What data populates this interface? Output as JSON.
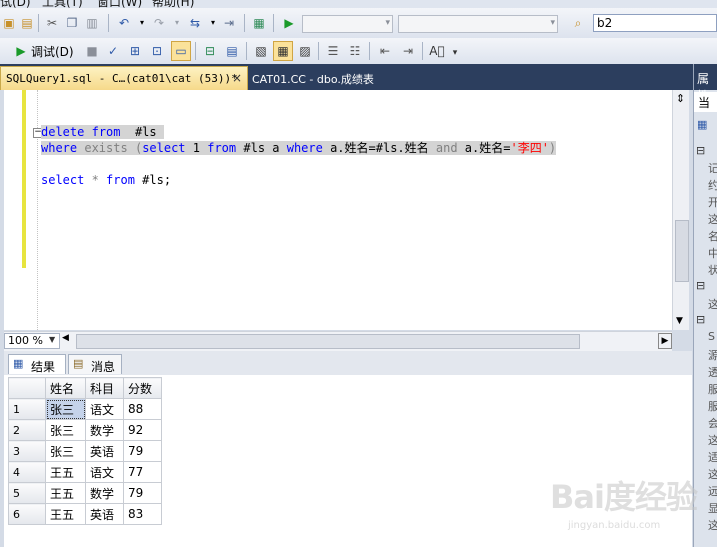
{
  "menubar": {
    "items": [
      "试(D)",
      "工具(T)",
      "窗口(W)",
      "帮助(H)"
    ]
  },
  "toolbar1": {
    "search_value": "b2"
  },
  "toolbar2": {
    "debug_label": "调试(D)"
  },
  "tabs": [
    {
      "label": "SQLQuery1.sql - C…(cat01\\cat (53))*",
      "close": "×",
      "active": true
    },
    {
      "label": "CAT01.CC - dbo.成绩表",
      "active": false
    }
  ],
  "editor": {
    "line1": {
      "kw1": "delete",
      "kw2": "from",
      "rest": "#ls"
    },
    "line2": {
      "kw_where": "where",
      "exists": "exists",
      "paren_open": "(",
      "kw_select": "select",
      "one": " 1 ",
      "kw_from": "from",
      "mid": " #ls a ",
      "kw_where2": "where",
      "cond": " a.姓名=#ls.姓名 ",
      "and": "and",
      "cond2": " a.姓名=",
      "str": "'李四'",
      "paren_close": ")"
    },
    "line3": {
      "kw_select": "select",
      "star": " * ",
      "kw_from": "from",
      "rest": " #ls;"
    }
  },
  "zoom": "100 %",
  "results_tabs": [
    {
      "label": "结果",
      "icon": "grid-icon"
    },
    {
      "label": "消息",
      "icon": "message-icon"
    }
  ],
  "grid": {
    "columns": [
      "姓名",
      "科目",
      "分数"
    ],
    "rows": [
      {
        "n": "1",
        "name": "张三",
        "subject": "语文",
        "score": "88"
      },
      {
        "n": "2",
        "name": "张三",
        "subject": "数学",
        "score": "92"
      },
      {
        "n": "3",
        "name": "张三",
        "subject": "英语",
        "score": "79"
      },
      {
        "n": "4",
        "name": "王五",
        "subject": "语文",
        "score": "77"
      },
      {
        "n": "5",
        "name": "王五",
        "subject": "数学",
        "score": "79"
      },
      {
        "n": "6",
        "name": "王五",
        "subject": "英语",
        "score": "83"
      }
    ]
  },
  "right_panel": {
    "title": "属性",
    "object": "当",
    "rows": [
      "记",
      "约",
      "开",
      "这",
      "名",
      "中",
      "状",
      "这",
      "这",
      "S",
      "源",
      "透",
      "服",
      "服",
      "会",
      "这",
      "适",
      "这",
      "远",
      "显"
    ]
  },
  "watermark": {
    "brand": "Bai度经验",
    "url": "jingyan.baidu.com"
  }
}
